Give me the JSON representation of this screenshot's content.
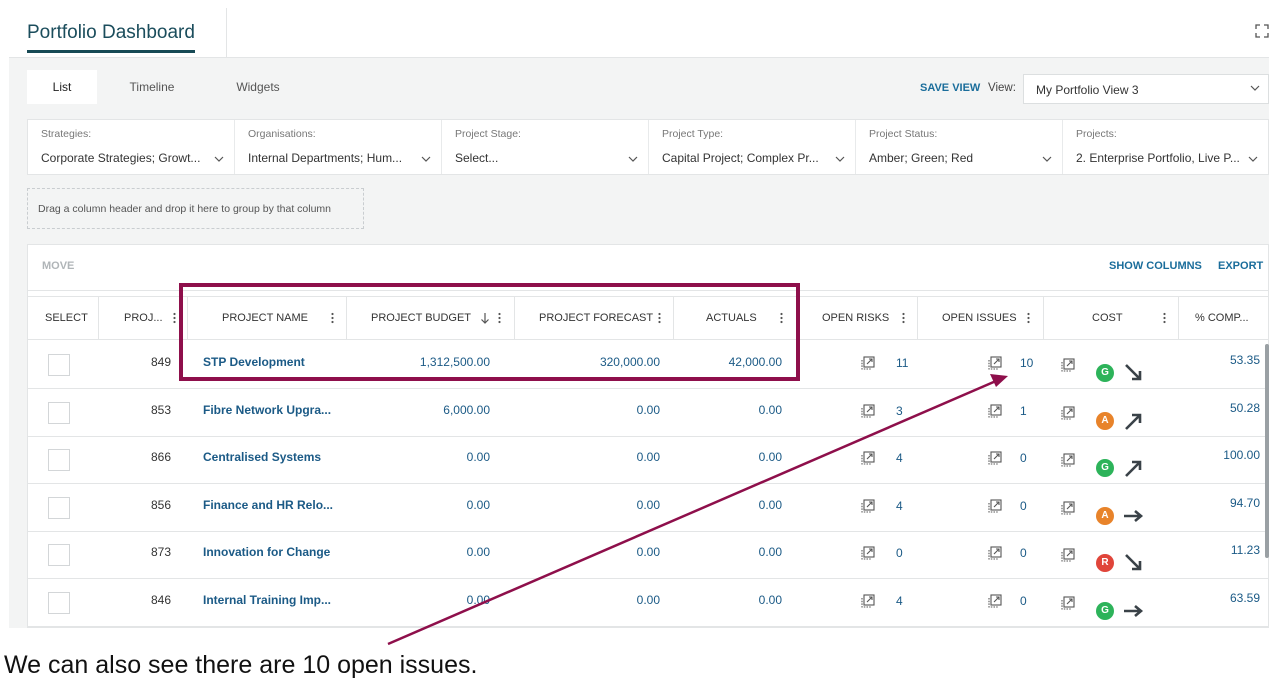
{
  "app": {
    "title": "Portfolio Dashboard"
  },
  "tabs": [
    "List",
    "Timeline",
    "Widgets"
  ],
  "toolbar_top": {
    "save_view": "SAVE VIEW",
    "view_label": "View:",
    "view_value": "My Portfolio View 3"
  },
  "filters": [
    {
      "label": "Strategies:",
      "value": "Corporate Strategies; Growt..."
    },
    {
      "label": "Organisations:",
      "value": "Internal Departments; Hum..."
    },
    {
      "label": "Project Stage:",
      "value": "Select..."
    },
    {
      "label": "Project Type:",
      "value": "Capital Project; Complex Pr..."
    },
    {
      "label": "Project Status:",
      "value": "Amber; Green; Red"
    },
    {
      "label": "Projects:",
      "value": "2. Enterprise Portfolio, Live P..."
    }
  ],
  "group_hint": "Drag a column header and drop it here to group by that column",
  "grid_toolbar": {
    "move": "MOVE",
    "show_columns": "SHOW COLUMNS",
    "export": "EXPORT"
  },
  "columns": {
    "select": "SELECT",
    "proj": "PROJ...",
    "name": "PROJECT NAME",
    "budget": "PROJECT BUDGET",
    "forecast": "PROJECT FORECAST",
    "actuals": "ACTUALS",
    "risks": "OPEN RISKS",
    "issues": "OPEN ISSUES",
    "cost": "COST",
    "comp": "% COMP..."
  },
  "rows": [
    {
      "id": "849",
      "name": "STP Development",
      "budget": "1,312,500.00",
      "forecast": "320,000.00",
      "actuals": "42,000.00",
      "risks": "11",
      "issues": "10",
      "rag": "G",
      "rag_color": "#2db35a",
      "trend": "down",
      "pct": "53.35"
    },
    {
      "id": "853",
      "name": "Fibre Network Upgra...",
      "budget": "6,000.00",
      "forecast": "0.00",
      "actuals": "0.00",
      "risks": "3",
      "issues": "1",
      "rag": "A",
      "rag_color": "#e8832a",
      "trend": "up",
      "pct": "50.28"
    },
    {
      "id": "866",
      "name": "Centralised Systems",
      "budget": "0.00",
      "forecast": "0.00",
      "actuals": "0.00",
      "risks": "4",
      "issues": "0",
      "rag": "G",
      "rag_color": "#2db35a",
      "trend": "up",
      "pct": "100.00"
    },
    {
      "id": "856",
      "name": "Finance and HR Relo...",
      "budget": "0.00",
      "forecast": "0.00",
      "actuals": "0.00",
      "risks": "4",
      "issues": "0",
      "rag": "A",
      "rag_color": "#e8832a",
      "trend": "flat",
      "pct": "94.70"
    },
    {
      "id": "873",
      "name": "Innovation for Change",
      "budget": "0.00",
      "forecast": "0.00",
      "actuals": "0.00",
      "risks": "0",
      "issues": "0",
      "rag": "R",
      "rag_color": "#e0453a",
      "trend": "down",
      "pct": "11.23"
    },
    {
      "id": "846",
      "name": "Internal Training Imp...",
      "budget": "0.00",
      "forecast": "0.00",
      "actuals": "0.00",
      "risks": "4",
      "issues": "0",
      "rag": "G",
      "rag_color": "#2db35a",
      "trend": "flat",
      "pct": "63.59"
    }
  ],
  "annotation": {
    "caption": "We can also see there are 10 open issues.",
    "color": "#8e0f4b"
  },
  "colors": {
    "link": "#1b5a86",
    "accent": "#1a6d9b",
    "title": "#1b4d5c"
  }
}
